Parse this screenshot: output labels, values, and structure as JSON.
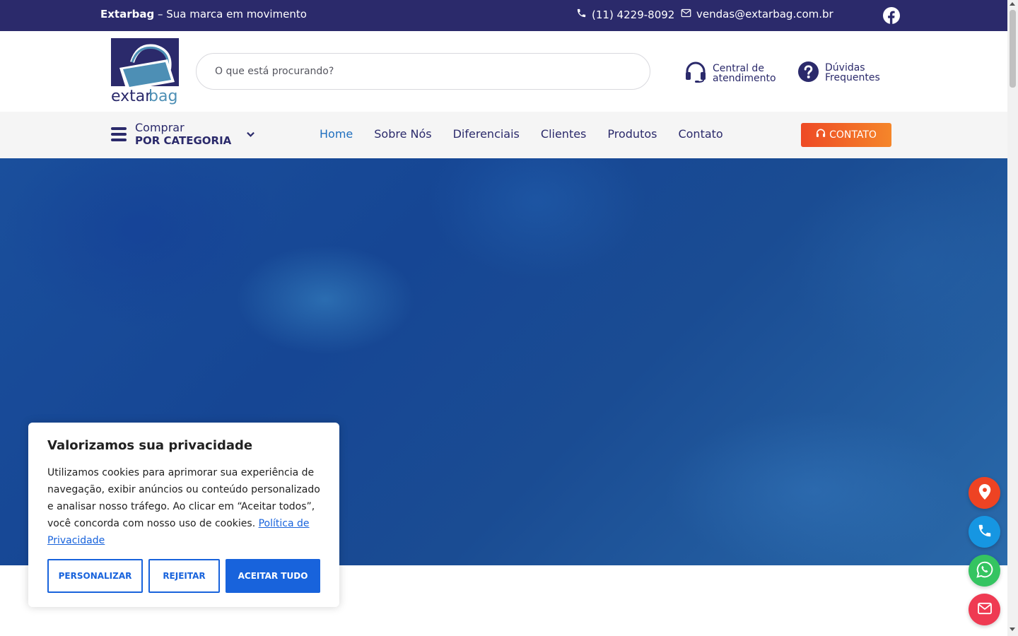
{
  "topbar": {
    "brand_bold": "Extarbag",
    "brand_rest": " – Sua marca em movimento",
    "phone": "(11) 4229-8092",
    "email": "vendas@extarbag.com.br"
  },
  "header": {
    "logo_text_a": "extar",
    "logo_text_b": "bag",
    "search_placeholder": "O que está procurando?",
    "support_line1": "Central de",
    "support_line2": "atendimento",
    "faq_line1": "Dúvidas",
    "faq_line2": "Frequentes"
  },
  "nav": {
    "category_line1": "Comprar",
    "category_line2": "POR CATEGORIA",
    "items": [
      "Home",
      "Sobre Nós",
      "Diferenciais",
      "Clientes",
      "Produtos",
      "Contato"
    ],
    "active": "Home",
    "cta": "CONTATO"
  },
  "cookie": {
    "title": "Valorizamos sua privacidade",
    "text": "Utilizamos cookies para aprimorar sua experiência de navegação, exibir anúncios ou conteúdo personalizado e analisar nosso tráfego. Ao clicar em “Aceitar todos”, você concorda com nosso uso de cookies.",
    "policy_link": "Política de Privacidade",
    "btn_customize": "PERSONALIZAR",
    "btn_reject": "REJEITAR",
    "btn_accept": "ACEITAR TUDO"
  },
  "floating": [
    "map-pin-icon",
    "phone-icon",
    "whatsapp-icon",
    "mail-icon"
  ],
  "colors": {
    "topbar": "#2b2a6b",
    "brand_navy": "#2b2a6b",
    "active_link": "#1f6fbf",
    "cta_start": "#ee4a25",
    "cta_end": "#f5862a",
    "cookie_blue": "#1863dc",
    "hero": "#1a4f9c"
  }
}
